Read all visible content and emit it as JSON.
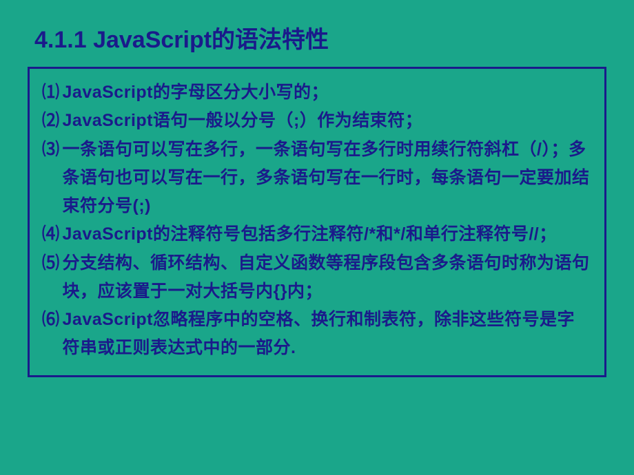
{
  "slide": {
    "heading": "4.1.1  JavaScript的语法特性",
    "items": [
      {
        "marker": "⑴",
        "text": "JavaScript的字母区分大小写的；"
      },
      {
        "marker": "⑵",
        "text": "JavaScript语句一般以分号（;）作为结束符；"
      },
      {
        "marker": "⑶",
        "text": "一条语句可以写在多行，一条语句写在多行时用续行符斜杠（/）；多条语句也可以写在一行，多条语句写在一行时，每条语句一定要加结束符分号(;)"
      },
      {
        "marker": "⑷",
        "text": "JavaScript的注释符号包括多行注释符/*和*/和单行注释符号//；"
      },
      {
        "marker": "⑸",
        "text": "分支结构、循环结构、自定义函数等程序段包含多条语句时称为语句块，应该置于一对大括号内{}内；"
      },
      {
        "marker": "⑹",
        "text": "JavaScript忽略程序中的空格、换行和制表符，除非这些符号是字符串或正则表达式中的一部分."
      }
    ]
  }
}
